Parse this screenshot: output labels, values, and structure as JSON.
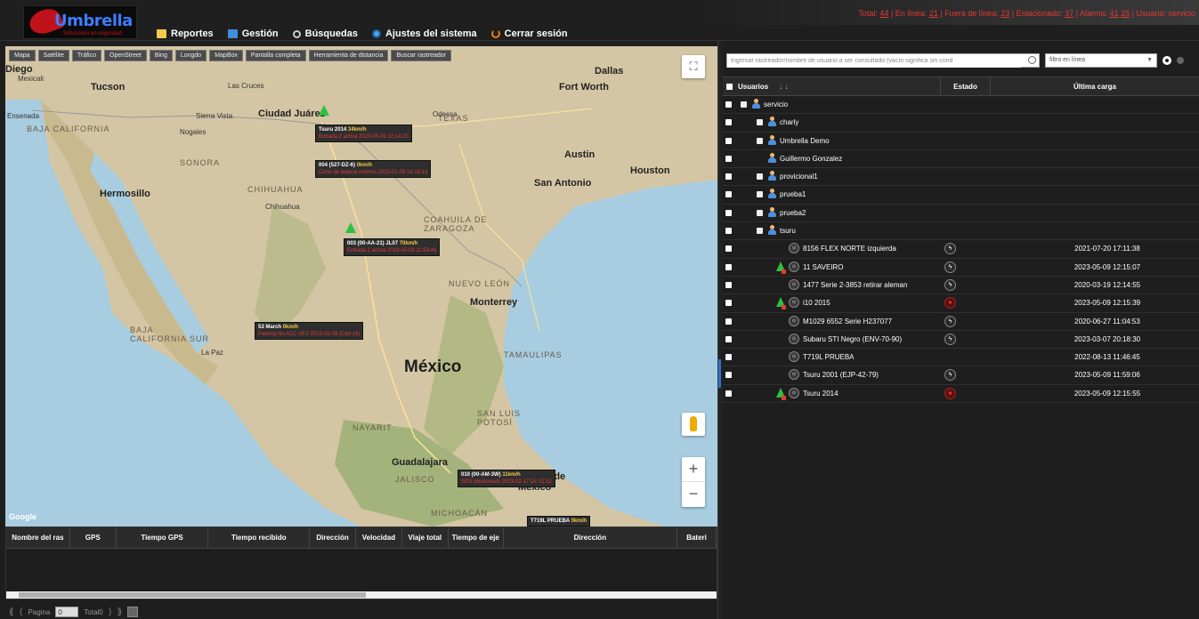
{
  "app": {
    "brand": "Umbrella",
    "brand_sub": "Soluciones en seguridad"
  },
  "nav": {
    "items": [
      {
        "label": "Reportes",
        "icon": "reports-icon"
      },
      {
        "label": "Gestión",
        "icon": "management-icon"
      },
      {
        "label": "Búsquedas",
        "icon": "search-icon"
      },
      {
        "label": "Ajustes del sistema",
        "icon": "settings-icon"
      },
      {
        "label": "Cerrar sesión",
        "icon": "logout-icon"
      }
    ]
  },
  "status": {
    "total_label": "Total:",
    "total": "44",
    "online_label": "En línea:",
    "online": "21",
    "offline_label": "Fuera de línea:",
    "offline": "23",
    "parked_label": "Estacionado:",
    "parked": "37",
    "alarm_label": "Alarma:",
    "alarm": "41",
    "alarm_extra": "25",
    "user_label": "Usuario:",
    "user": "servicio"
  },
  "map": {
    "toolbar": [
      "Mapa",
      "Satélite",
      "Tráfico",
      "OpenStreet",
      "Bing",
      "Longdo",
      "MapBox",
      "Pantalla completa",
      "Herramienta de distancia",
      "Buscar rastreador"
    ],
    "country_label": "México",
    "google": "Google",
    "labels": {
      "diego": "Diego",
      "tucson": "Tucson",
      "las_cruces": "Las Cruces",
      "el_paso": "Ciudad Juárez",
      "dallas": "Dallas",
      "fort_worth": "Fort Worth",
      "texas": "TEXAS",
      "austin": "Austin",
      "houston": "Houston",
      "san_antonio": "San Antonio",
      "hermosillo": "Hermosillo",
      "sonora": "SONORA",
      "chihuahua_state": "CHIHUAHUA",
      "chihuahua": "Chihuahua",
      "coahuila": "COAHUILA DE ZARAGOZA",
      "nuevo_leon": "NUEVO LEÓN",
      "monterrey": "Monterrey",
      "tamaulipas": "TAMAULIPAS",
      "baja_cal": "BAJA CALIFORNIA",
      "baja_cal_sur": "BAJA CALIFORNIA SUR",
      "nayarit": "NAYARIT",
      "guadalajara": "Guadalajara",
      "jalisco": "JALISCO",
      "san_luis": "SAN LUIS POTOSÍ",
      "michoacan": "MICHOACÁN",
      "mexico_city": "Ciudad de México",
      "mexicali": "Mexicali",
      "ensenada": "Ensenada",
      "nogales": "Nogales",
      "sierra_vista": "Sierra Vista",
      "odessa": "Odessa",
      "la_paz": "La Paz"
    },
    "vehicles": [
      {
        "name": "Tsuru 2014",
        "speed": "34km/h",
        "status": "Entrada 2 activa 2023-05-09 12:14:20"
      },
      {
        "name": "004 (527-DZ-6)",
        "speed": "0km/h",
        "status": "Corte de batería externa 2023-01-09 14:16:13"
      },
      {
        "name": "003 (00-AA-21) JL07",
        "speed": "70km/h",
        "status": "Entrada 2 activa 2023-05-09 11:53:46"
      },
      {
        "name": "53 March",
        "speed": "0km/h",
        "status": "Parking No ACC off 0 2023-05-09 (Cdd 16)"
      },
      {
        "name": "010 (00-AM-3W)",
        "speed": "11km/h",
        "status": "SOS presionado 2023-02-17 Dc 01:52"
      },
      {
        "name": "T719L PRUEBA",
        "speed": "0km/h",
        "status": ""
      }
    ]
  },
  "grid": {
    "columns": [
      "Nombre del ras",
      "GPS",
      "Tiempo GPS",
      "Tiempo recibido",
      "Dirección",
      "Velocidad",
      "Viaje total",
      "Tiempo de eje",
      "Dirección",
      "Bateri"
    ]
  },
  "pager": {
    "first": "⟪",
    "prev": "⟨",
    "page_label": "Pagina",
    "page_value": "0",
    "total_label": "Total0",
    "next": "⟩",
    "last": "⟫"
  },
  "right": {
    "search_placeholder": "Ingresar rastreador/nombre de usuario a ser consultado (vacío significa sin cond",
    "filter_value": "filtro en línea",
    "columns": {
      "users": "Usuarios",
      "state": "Estado",
      "last": "Última carga"
    },
    "tree": [
      {
        "level": 0,
        "type": "user",
        "label": "servicio",
        "expander": true
      },
      {
        "level": 1,
        "type": "user",
        "label": "charly",
        "expander": true
      },
      {
        "level": 1,
        "type": "user",
        "label": "Umbrella Demo",
        "expander": true
      },
      {
        "level": 1,
        "type": "user",
        "label": "Guillermo Gonzalez",
        "expander": false
      },
      {
        "level": 1,
        "type": "user",
        "label": "provicional1",
        "expander": true
      },
      {
        "level": 1,
        "type": "user",
        "label": "prueba1",
        "expander": true
      },
      {
        "level": 1,
        "type": "user",
        "label": "prueba2",
        "expander": true
      },
      {
        "level": 1,
        "type": "user",
        "label": "tsuru",
        "expander": true
      },
      {
        "level": 2,
        "type": "device",
        "label": "8156 FLEX NORTE izquierda",
        "moving": false,
        "state": "ok",
        "date": "2021-07-20 17:11:38"
      },
      {
        "level": 2,
        "type": "device",
        "label": "11 SAVEIRO",
        "moving": true,
        "state": "ok",
        "date": "2023-05-09 12:15:07"
      },
      {
        "level": 2,
        "type": "device",
        "label": "1477 Serie 2-3853 retirar aleman",
        "moving": false,
        "state": "ok",
        "date": "2020-03-19 12:14:55"
      },
      {
        "level": 2,
        "type": "device",
        "label": "i10 2015",
        "moving": true,
        "state": "alarm",
        "date": "2023-05-09 12:15:39"
      },
      {
        "level": 2,
        "type": "device",
        "label": "M1029 6552 Serie H237077",
        "moving": false,
        "state": "ok",
        "date": "2020-06-27 11:04:53"
      },
      {
        "level": 2,
        "type": "device",
        "label": "Subaru STI Negro (ENV-70-90)",
        "moving": false,
        "state": "ok",
        "date": "2023-03-07 20:18:30"
      },
      {
        "level": 2,
        "type": "device",
        "label": "T719L PRUEBA",
        "moving": false,
        "state": "",
        "date": "2022-08-13 11:46:45"
      },
      {
        "level": 2,
        "type": "device",
        "label": "Tsuru 2001 (EJP-42-79)",
        "moving": false,
        "state": "ok",
        "date": "2023-05-09 11:59:06"
      },
      {
        "level": 2,
        "type": "device",
        "label": "Tsuru 2014",
        "moving": true,
        "state": "alarm",
        "date": "2023-05-09 12:15:55"
      }
    ]
  },
  "colors": {
    "accent": "#3e8ede",
    "alarm": "#e53935",
    "moving": "#2fbf3f",
    "speed": "#f3c94b"
  }
}
